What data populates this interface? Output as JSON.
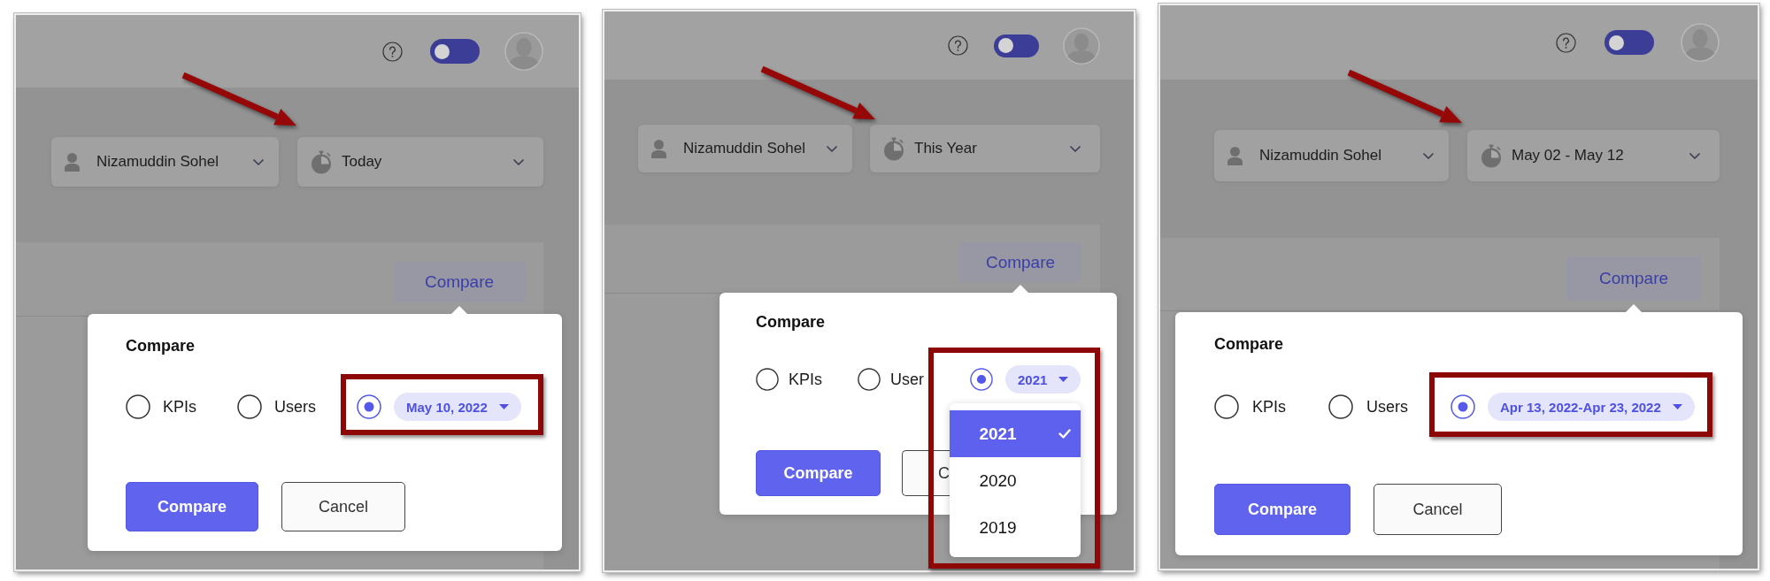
{
  "panels": [
    {
      "header": {
        "toggle": {
          "on": false
        }
      },
      "filters": [
        {
          "kind": "user",
          "label": "Nizamuddin Sohel"
        },
        {
          "kind": "period",
          "label": "Today"
        }
      ],
      "compare_button": "Compare",
      "popover": {
        "title": "Compare",
        "options": [
          {
            "kind": "radio",
            "label": "KPIs",
            "selected": false
          },
          {
            "kind": "radio",
            "label": "Users",
            "selected": false
          },
          {
            "kind": "period",
            "value": "May 10, 2022",
            "selected": true
          }
        ],
        "buttons": [
          {
            "kind": "primary",
            "label": "Compare"
          },
          {
            "kind": "secondary",
            "label": "Cancel"
          }
        ]
      }
    },
    {
      "header": {
        "toggle": {
          "on": false
        }
      },
      "filters": [
        {
          "kind": "user",
          "label": "Nizamuddin Sohel"
        },
        {
          "kind": "period",
          "label": "This Year"
        }
      ],
      "compare_button": "Compare",
      "popover": {
        "title": "Compare",
        "options": [
          {
            "kind": "radio",
            "label": "KPIs",
            "selected": false
          },
          {
            "kind": "radio",
            "label": "User",
            "selected": false
          },
          {
            "kind": "period",
            "value": "2021",
            "selected": true,
            "menu": [
              {
                "label": "2021",
                "selected": true
              },
              {
                "label": "2020",
                "selected": false
              },
              {
                "label": "2019",
                "selected": false
              }
            ]
          }
        ],
        "buttons": [
          {
            "kind": "primary",
            "label": "Compare"
          },
          {
            "kind": "secondary",
            "label": "C"
          }
        ]
      }
    },
    {
      "header": {
        "toggle": {
          "on": false
        }
      },
      "filters": [
        {
          "kind": "user",
          "label": "Nizamuddin Sohel"
        },
        {
          "kind": "period",
          "label": "May 02 - May 12"
        }
      ],
      "compare_button": "Compare",
      "popover": {
        "title": "Compare",
        "options": [
          {
            "kind": "radio",
            "label": "KPIs",
            "selected": false
          },
          {
            "kind": "radio",
            "label": "Users",
            "selected": false
          },
          {
            "kind": "period",
            "value": "Apr 13, 2022-Apr 23, 2022",
            "selected": true
          }
        ],
        "buttons": [
          {
            "kind": "primary",
            "label": "Compare"
          },
          {
            "kind": "secondary",
            "label": "Cancel"
          }
        ]
      }
    }
  ]
}
